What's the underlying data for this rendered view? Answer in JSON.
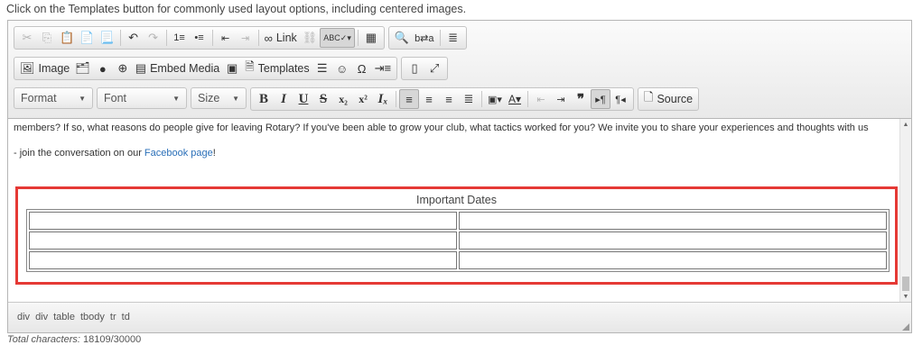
{
  "instruction": "Click on the Templates button for commonly used layout options, including centered images.",
  "toolbar": {
    "row1": [
      "✂",
      "⎘",
      "📋",
      "📋",
      "📋",
      "↶",
      "↷",
      "⒈",
      "•",
      "⇤",
      "⇥",
      "∞",
      "⛓",
      "ABC",
      "▦",
      "🔍",
      "⇄",
      "≣"
    ],
    "link_label": "Link",
    "image_label": "Image",
    "embed_label": "Embed Media",
    "templates_label": "Templates",
    "format_label": "Format",
    "font_label": "Font",
    "size_label": "Size",
    "source_label": "Source"
  },
  "content": {
    "paragraph1": "members? If so, what reasons do people give for leaving Rotary? If you've been able to grow your club, what tactics worked for you? We invite you to share your experiences and thoughts with us",
    "paragraph2_prefix": "- join the conversation on our ",
    "paragraph2_link": "Facebook page",
    "paragraph2_suffix": "!",
    "table_caption": "Important Dates",
    "table_rows": 3,
    "table_cols": 2
  },
  "statusbar": {
    "path": [
      "div",
      "div",
      "table",
      "tbody",
      "tr",
      "td"
    ]
  },
  "footer": {
    "label": "Total characters:",
    "value": "18109/30000"
  },
  "colors": {
    "highlight": "#e53935",
    "link": "#2a6fb8"
  }
}
